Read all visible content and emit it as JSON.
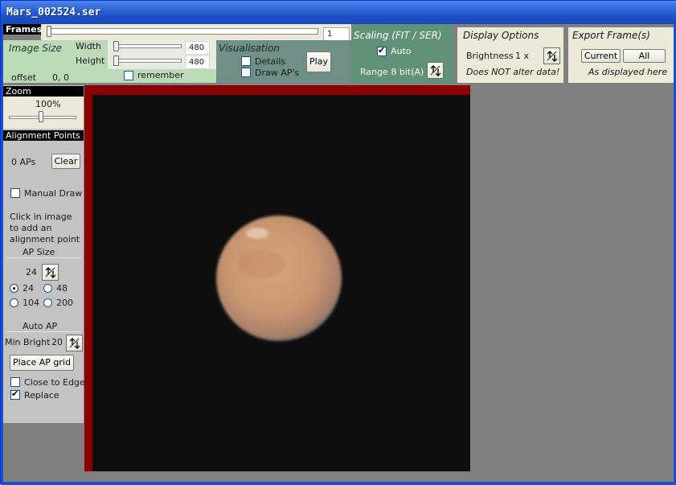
{
  "window": {
    "title": "Mars_002524.ser"
  },
  "frames": {
    "label": "Frames",
    "value": "1"
  },
  "image_size": {
    "title": "Image Size",
    "width_label": "Width",
    "width_value": "480",
    "height_label": "Height",
    "height_value": "480",
    "offset_label": "offset",
    "offset_value": "0, 0",
    "remember_label": "remember"
  },
  "visualisation": {
    "title": "Visualisation",
    "details_label": "Details",
    "draw_aps_label": "Draw AP's",
    "play_label": "Play"
  },
  "scaling": {
    "title": "Scaling (FIT / SER)",
    "auto_label": "Auto",
    "range_label": "Range 8 bit(A)"
  },
  "display_options": {
    "title": "Display Options",
    "brightness_label": "Brightness",
    "brightness_value": "1 x",
    "note": "Does NOT alter data!"
  },
  "export": {
    "title": "Export Frame(s)",
    "current_label": "Current",
    "all_label": "All",
    "note": "As displayed here"
  },
  "zoom": {
    "label": "Zoom",
    "value": "100%"
  },
  "alignment": {
    "header": "Alignment Points",
    "ap_count": "0 APs",
    "clear_label": "Clear",
    "manual_draw_label": "Manual Draw",
    "hint_line1": "Click in image",
    "hint_line2": "to add an",
    "hint_line3": "alignment point",
    "ap_size_label": "AP Size",
    "ap_size_value": "24",
    "size_options": [
      "24",
      "48",
      "104",
      "200"
    ],
    "auto_ap_label": "Auto AP",
    "min_bright_label": "Min Bright",
    "min_bright_value": "20",
    "place_grid_label": "Place AP grid",
    "close_to_edge_label": "Close to Edge",
    "replace_label": "Replace"
  },
  "colors": {
    "image_size_panel": "#bcd9b8",
    "visualisation_panel": "#6f8f86",
    "scaling_panel": "#5f9277",
    "options_panel": "#ece9d8",
    "image_border": "#8b0000"
  }
}
